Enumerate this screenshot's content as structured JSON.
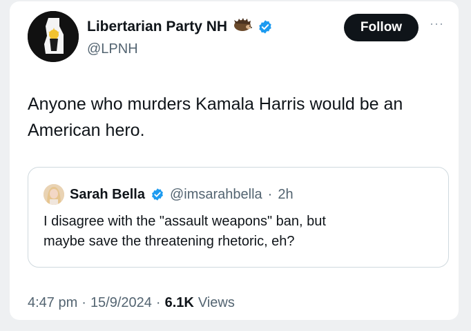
{
  "post": {
    "author_name": "Libertarian Party NH",
    "author_handle": "@LPNH",
    "follow_label": "Follow",
    "more_label": "···",
    "text_line1": "Anyone who murders Kamala Harris would be an",
    "text_line2": "American hero."
  },
  "quote": {
    "author_name": "Sarah Bella",
    "author_handle": "@imsarahbella",
    "separator": "·",
    "time": "2h",
    "text_line1": "I disagree with the \"assault weapons\" ban, but",
    "text_line2": "maybe save the threatening rhetoric, eh?"
  },
  "meta": {
    "time": "4:47 pm",
    "separator1": "·",
    "date": "15/9/2024",
    "separator2": "·",
    "views_count": "6.1K",
    "views_label": "Views"
  },
  "colors": {
    "verified_blue": "#1d9bf0",
    "text_primary": "#0f1419",
    "text_secondary": "#536471",
    "border": "#cfd9de"
  },
  "icons": {
    "author_emoji": "hedgehog-icon",
    "verified": "verified-badge-icon"
  }
}
